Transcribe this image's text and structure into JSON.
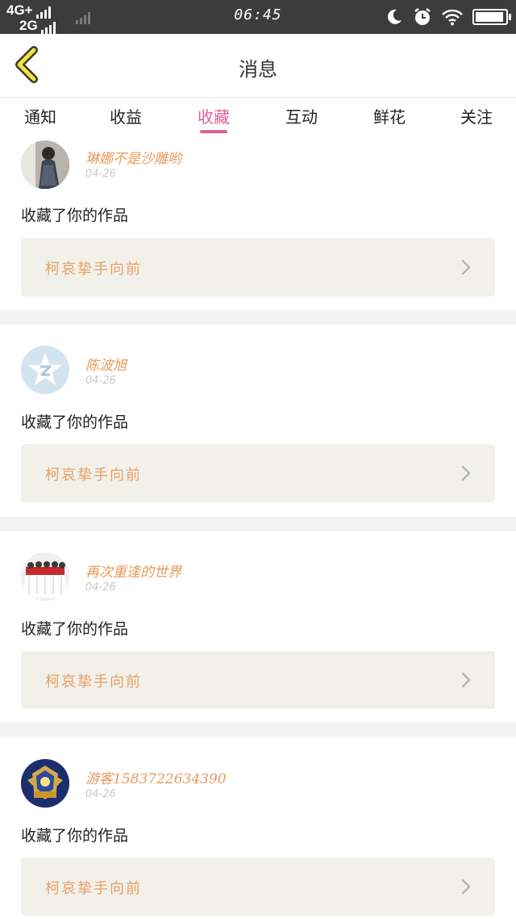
{
  "status_bar": {
    "network_top": "4G+",
    "network_bottom": "2G",
    "time": "06:45"
  },
  "header": {
    "title": "消息"
  },
  "tabs": [
    {
      "label": "通知"
    },
    {
      "label": "收益"
    },
    {
      "label": "收藏"
    },
    {
      "label": "互动"
    },
    {
      "label": "鲜花"
    },
    {
      "label": "关注"
    }
  ],
  "active_tab": "收藏",
  "messages": [
    {
      "username": "琳娜不是沙雕哟",
      "date": "04-26",
      "action": "收藏了你的作品",
      "work_title": "柯哀挚手向前"
    },
    {
      "username": "陈波旭",
      "date": "04-26",
      "action": "收藏了你的作品",
      "work_title": "柯哀挚手向前"
    },
    {
      "username": "再次重逢的世界",
      "date": "04-26",
      "action": "收藏了你的作品",
      "work_title": "柯哀挚手向前"
    },
    {
      "username": "游客1583722634390",
      "date": "04-26",
      "action": "收藏了你的作品",
      "work_title": "柯哀挚手向前"
    }
  ],
  "colors": {
    "accent_pink": "#e0609a",
    "username_orange": "#e89a5a",
    "work_box_bg": "#f1f1ea",
    "status_bar_bg": "#3c3c3c"
  }
}
